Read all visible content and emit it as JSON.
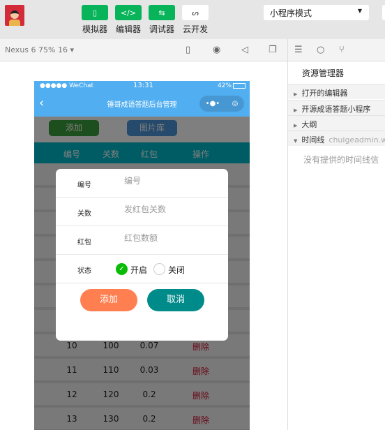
{
  "toolbar": {
    "buttons": [
      {
        "label": "模拟器",
        "icon": "phone-icon"
      },
      {
        "label": "编辑器",
        "icon": "code-icon"
      },
      {
        "label": "调试器",
        "icon": "sliders-icon"
      },
      {
        "label": "云开发",
        "icon": "cloud-link-icon"
      }
    ],
    "mode": "小程序模式"
  },
  "devicebar": {
    "device": "Nexus 6 75% 16 ▾"
  },
  "right": {
    "title": "资源管理器",
    "sections": [
      {
        "label": "打开的编辑器"
      },
      {
        "label": "开源成语答题小程序"
      },
      {
        "label": "大纲"
      },
      {
        "label": "时间线",
        "sub": "chuigeadmin.w"
      }
    ],
    "empty": "没有提供的时间线信"
  },
  "phone": {
    "status": {
      "carrier": "●●●●● WeChat",
      "time": "13:31",
      "battery": "42%"
    },
    "title": "锤哥成语答题后台管理",
    "add": "添加",
    "gallery": "图片库",
    "headers": [
      "编号",
      "关数",
      "红包",
      "操作"
    ],
    "rows": [
      [
        "10",
        "100",
        "0.07",
        "删除"
      ],
      [
        "11",
        "110",
        "0.03",
        "删除"
      ],
      [
        "12",
        "120",
        "0.2",
        "删除"
      ],
      [
        "13",
        "130",
        "0.2",
        "删除"
      ]
    ]
  },
  "modal": {
    "fields": [
      {
        "label": "编号",
        "placeholder": "编号"
      },
      {
        "label": "关数",
        "placeholder": "发红包关数"
      },
      {
        "label": "红包",
        "placeholder": "红包数额"
      }
    ],
    "status_label": "状态",
    "on": "开启",
    "off": "关闭",
    "status_value": "开启",
    "submit": "添加",
    "cancel": "取消"
  },
  "colors": {
    "accent": "#07b45a",
    "nav": "#51aef0",
    "header": "#00b9c9",
    "submit": "#ff7f50",
    "cancel": "#008b8b"
  }
}
